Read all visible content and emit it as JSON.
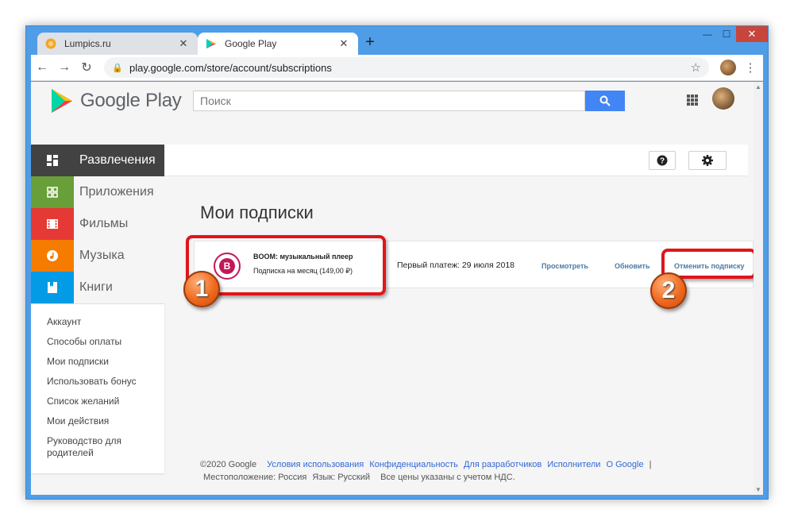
{
  "tabs": [
    {
      "title": "Lumpics.ru",
      "close": "✕"
    },
    {
      "title": "Google Play",
      "close": "✕"
    }
  ],
  "new_tab": "+",
  "window_controls": {
    "minimize": "—",
    "maximize": "☐",
    "close": "✕"
  },
  "address_bar": {
    "url": "play.google.com/store/account/subscriptions"
  },
  "store": {
    "logo_text": "Google Play",
    "search_placeholder": "Поиск"
  },
  "nav": {
    "categories": [
      {
        "label": "Развлечения"
      },
      {
        "label": "Приложения"
      },
      {
        "label": "Фильмы"
      },
      {
        "label": "Музыка"
      },
      {
        "label": "Книги"
      }
    ],
    "account_links": [
      "Аккаунт",
      "Способы оплаты",
      "Мои подписки",
      "Использовать бонус",
      "Список желаний",
      "Мои действия",
      "Руководство для родителей"
    ]
  },
  "main": {
    "title": "Мои подписки",
    "subscription": {
      "logo_letter": "B",
      "name": "BOOM: музыкальный плеер",
      "plan": "Подписка на месяц (149,00 ₽)",
      "first_payment": "Первый платеж: 29 июля 2018",
      "view": "Просмотреть",
      "update": "Обновить",
      "cancel": "Отменить подписку"
    }
  },
  "annotations": {
    "badge1": "1",
    "badge2": "2"
  },
  "footer": {
    "copyright": "©2020 Google",
    "links": [
      "Условия использования",
      "Конфиденциальность",
      "Для разработчиков",
      "Исполнители",
      "О Google"
    ],
    "separator": "|",
    "location": "Местоположение: Россия",
    "language": "Язык: Русский",
    "prices": "Все цены указаны с учетом НДС."
  },
  "colors": {
    "accent": "#4285f4",
    "highlight": "#e0151a",
    "badge": "#f06a1e"
  }
}
